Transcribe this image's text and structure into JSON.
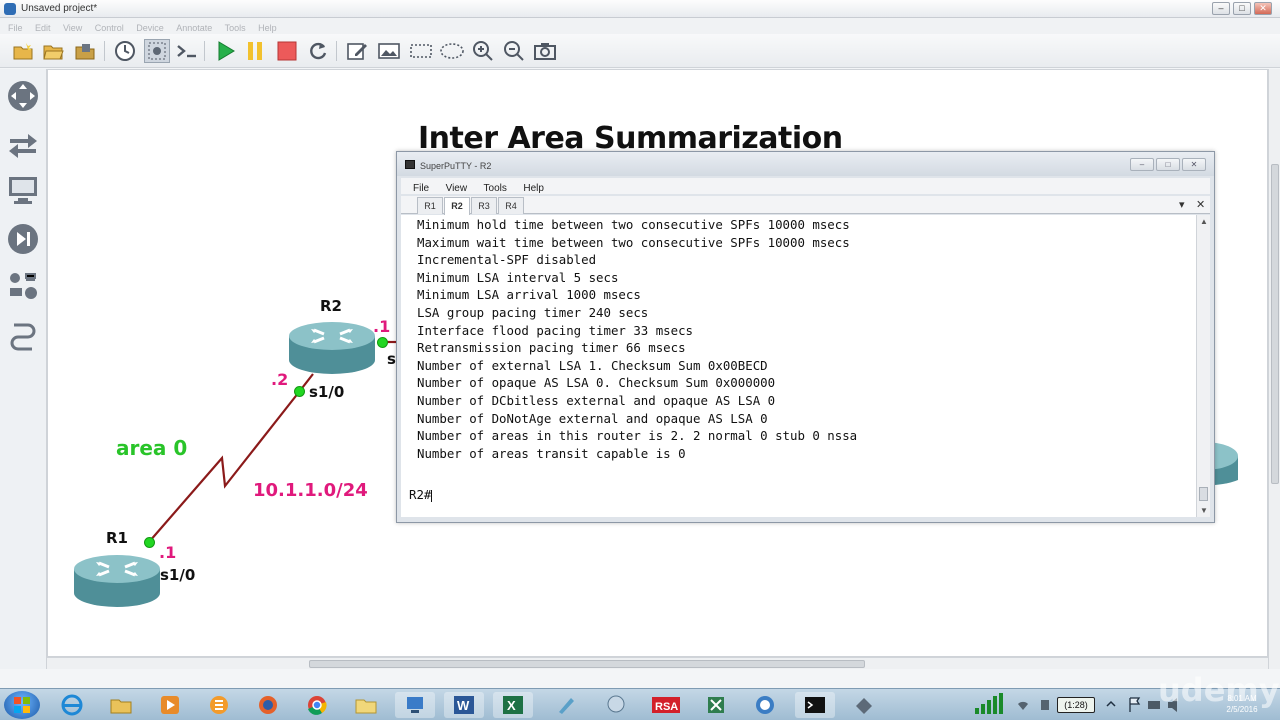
{
  "app": {
    "title": "Unsaved project*",
    "window_controls": [
      "–",
      "□",
      "✕"
    ]
  },
  "menubar": [
    "File",
    "Edit",
    "View",
    "Control",
    "Device",
    "Annotate",
    "Tools",
    "Help"
  ],
  "canvas": {
    "title": "Inter Area Summarization",
    "routers": {
      "r1": {
        "name": "R1",
        "interface": "s1/0",
        "ip": ".1"
      },
      "r2": {
        "name": "R2",
        "interface": "s1/0",
        "ip": ".2",
        "right_ip": ".1",
        "right_iface_partial": "s"
      }
    },
    "area_label": "area 0",
    "subnet_label": "10.1.1.0/24"
  },
  "putty": {
    "title": "SuperPuTTY - R2",
    "window_controls": [
      "–",
      "□",
      "✕"
    ],
    "menu": [
      "File",
      "View",
      "Tools",
      "Help"
    ],
    "tabs": [
      {
        "label": "R1",
        "active": false
      },
      {
        "label": "R2",
        "active": true
      },
      {
        "label": "R3",
        "active": false
      },
      {
        "label": "R4",
        "active": false
      }
    ],
    "terminal_lines": [
      "Minimum hold time between two consecutive SPFs 10000 msecs",
      "Maximum wait time between two consecutive SPFs 10000 msecs",
      "Incremental-SPF disabled",
      "Minimum LSA interval 5 secs",
      "Minimum LSA arrival 1000 msecs",
      "LSA group pacing timer 240 secs",
      "Interface flood pacing timer 33 msecs",
      "Retransmission pacing timer 66 msecs",
      "Number of external LSA 1. Checksum Sum 0x00BECD",
      "Number of opaque AS LSA 0. Checksum Sum 0x000000",
      "Number of DCbitless external and opaque AS LSA 0",
      "Number of DoNotAge external and opaque AS LSA 0",
      "Number of areas in this router is 2. 2 normal 0 stub 0 nssa",
      "Number of areas transit capable is 0"
    ],
    "prompt": "R2#"
  },
  "taskbar": {
    "apps": [
      "ie",
      "explorer",
      "media",
      "paint",
      "firefox",
      "chrome",
      "folder",
      "network",
      "word",
      "excel",
      "app",
      "app",
      "rsa",
      "excel-green",
      "app",
      "terminal",
      "app"
    ],
    "rsa_label": "RSA",
    "word_label": "W",
    "excel_label": "X",
    "battery": "(1:28)",
    "clock_time": "8:01 AM",
    "clock_date": "2/5/2016",
    "watermark": "udemy"
  }
}
